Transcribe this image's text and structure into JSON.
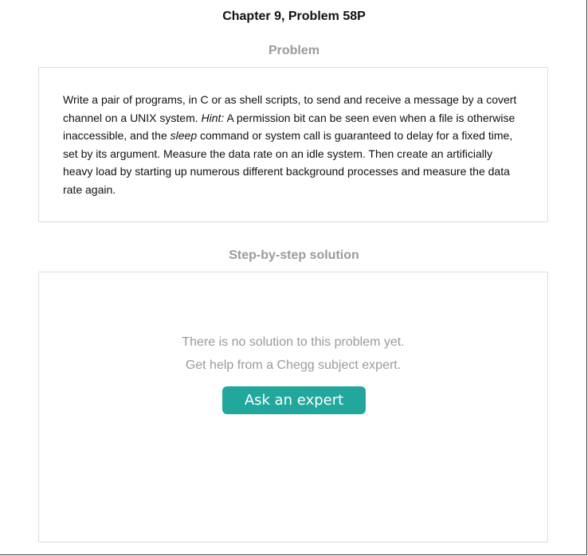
{
  "header": {
    "chapter_title": "Chapter 9, Problem 58P"
  },
  "problem": {
    "section_title": "Problem",
    "segments": [
      {
        "text": "Write a pair of programs, in C or as shell scripts, to send and receive a message by a covert channel on a UNIX system. ",
        "italic": false
      },
      {
        "text": "Hint:",
        "italic": true
      },
      {
        "text": " A permission bit can be seen even when a file is otherwise inaccessible, and the ",
        "italic": false
      },
      {
        "text": "sleep",
        "italic": true
      },
      {
        "text": " command or system call is guaranteed to delay for a fixed time, set by its argument. Measure the data rate on an idle system. Then create an artificially heavy load by starting up numerous different background processes and measure the data rate again.",
        "italic": false
      }
    ]
  },
  "solution": {
    "section_title": "Step-by-step solution",
    "empty_line_1": "There is no solution to this problem yet.",
    "empty_line_2": "Get help from a Chegg subject expert.",
    "ask_button_label": "Ask an expert"
  },
  "colors": {
    "accent": "#22a79c",
    "muted_text": "#9a9a9a",
    "border": "#dcdcdc"
  }
}
